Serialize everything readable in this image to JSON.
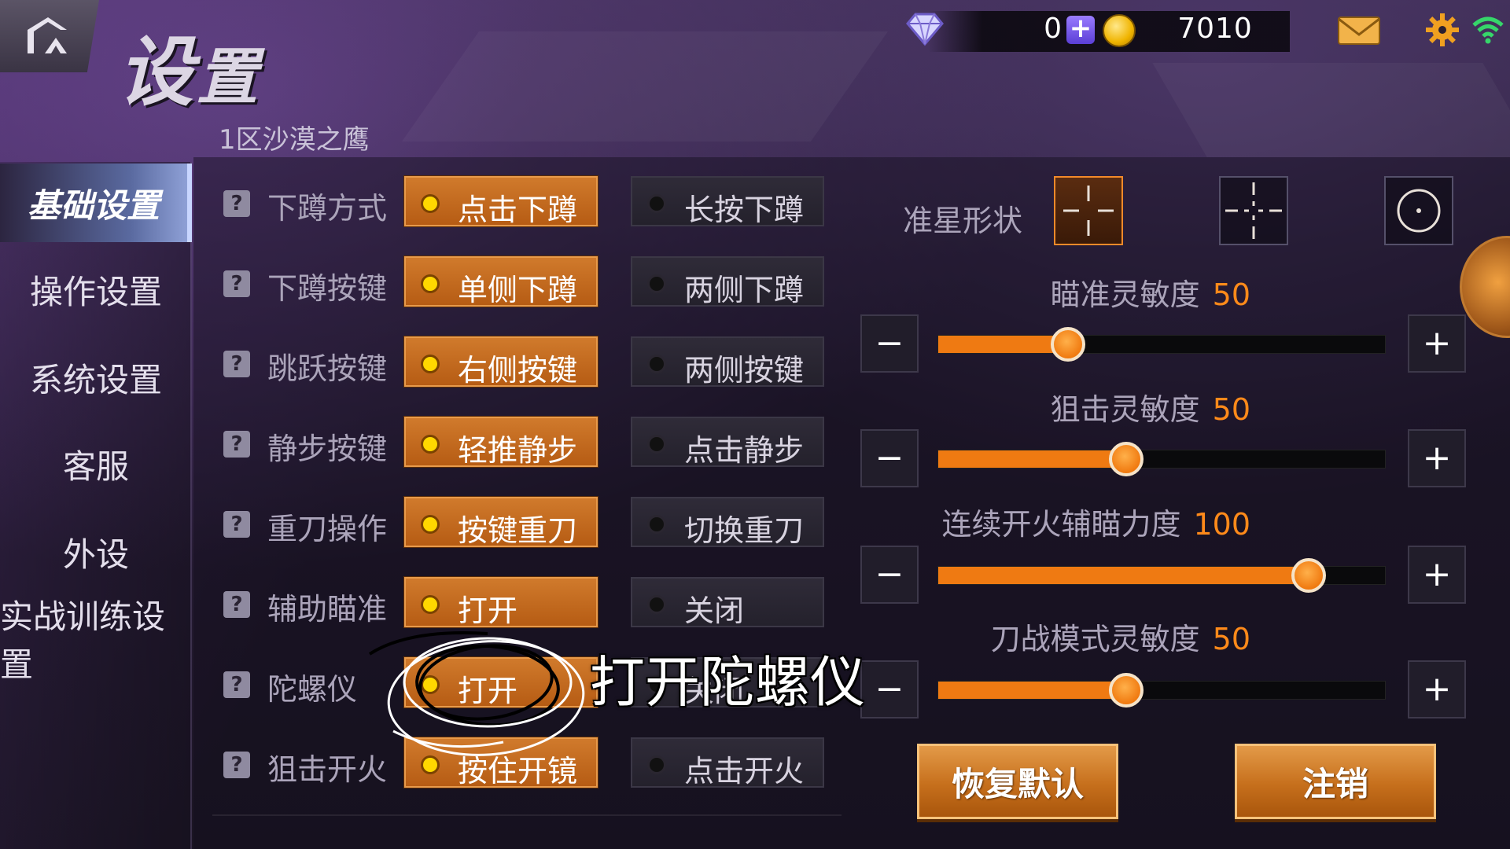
{
  "header": {
    "title_main": "设",
    "title_rest": "置",
    "diamond_count": "0",
    "add_symbol": "+",
    "coin_count": "7010"
  },
  "server_name": "1区沙漠之鹰",
  "sidebar": {
    "items": [
      {
        "label": "基础设置",
        "active": true
      },
      {
        "label": "操作设置"
      },
      {
        "label": "系统设置"
      },
      {
        "label": "客服"
      },
      {
        "label": "外设"
      },
      {
        "label": "实战训练设置"
      }
    ]
  },
  "settings": {
    "help_symbol": "?",
    "rows": [
      {
        "label": "下蹲方式",
        "on": "点击下蹲",
        "off": "长按下蹲"
      },
      {
        "label": "下蹲按键",
        "on": "单侧下蹲",
        "off": "两侧下蹲"
      },
      {
        "label": "跳跃按键",
        "on": "右侧按键",
        "off": "两侧按键"
      },
      {
        "label": "静步按键",
        "on": "轻推静步",
        "off": "点击静步"
      },
      {
        "label": "重刀操作",
        "on": "按键重刀",
        "off": "切换重刀"
      },
      {
        "label": "辅助瞄准",
        "on": "打开",
        "off": "关闭"
      },
      {
        "label": "陀螺仪",
        "on": "打开",
        "off": "关闭"
      },
      {
        "label": "狙击开火",
        "on": "按住开镜",
        "off": "点击开火"
      }
    ]
  },
  "crosshair": {
    "label": "准星形状",
    "options": [
      "cross-gap-icon",
      "cross-dash-icon",
      "circle-dot-icon"
    ],
    "selected_index": 0
  },
  "sliders": {
    "minus": "−",
    "plus": "+",
    "items": [
      {
        "label": "瞄准灵敏度",
        "value": "50",
        "fraction": 0.29
      },
      {
        "label": "狙击灵敏度",
        "value": "50",
        "fraction": 0.42
      },
      {
        "label": "连续开火辅瞄力度",
        "value": "100",
        "fraction": 0.83
      },
      {
        "label": "刀战模式灵敏度",
        "value": "50",
        "fraction": 0.42
      }
    ]
  },
  "buttons": {
    "restore_default": "恢复默认",
    "logout": "注销"
  },
  "annotation": {
    "text": "打开陀螺仪"
  },
  "colors": {
    "accent_orange": "#ef7a12",
    "value_orange": "#ff8a1a",
    "panel_bg": "#1d1626"
  }
}
